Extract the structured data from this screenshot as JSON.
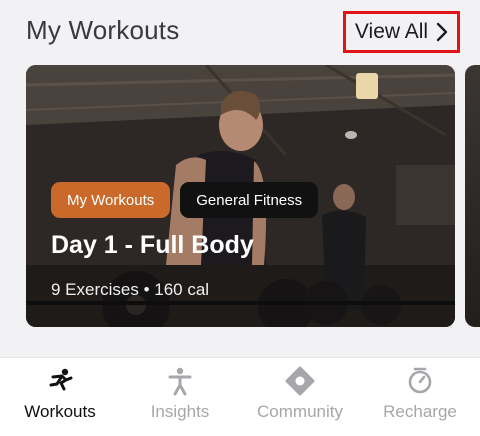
{
  "header": {
    "title": "My Workouts",
    "view_all_label": "View All"
  },
  "card": {
    "tags": [
      "My Workouts",
      "General Fitness"
    ],
    "title": "Day 1 - Full Body",
    "meta": "9 Exercises • 160 cal"
  },
  "tabbar": {
    "items": [
      {
        "label": "Workouts",
        "icon": "running-figure-icon",
        "active": true
      },
      {
        "label": "Insights",
        "icon": "person-icon",
        "active": false
      },
      {
        "label": "Community",
        "icon": "community-icon",
        "active": false
      },
      {
        "label": "Recharge",
        "icon": "timer-icon",
        "active": false
      }
    ]
  },
  "colors": {
    "accent": "#e1141b",
    "tag_primary": "#c9692a",
    "tag_secondary": "#111111",
    "tab_active": "#111111",
    "tab_inactive": "#a7a7ab"
  }
}
